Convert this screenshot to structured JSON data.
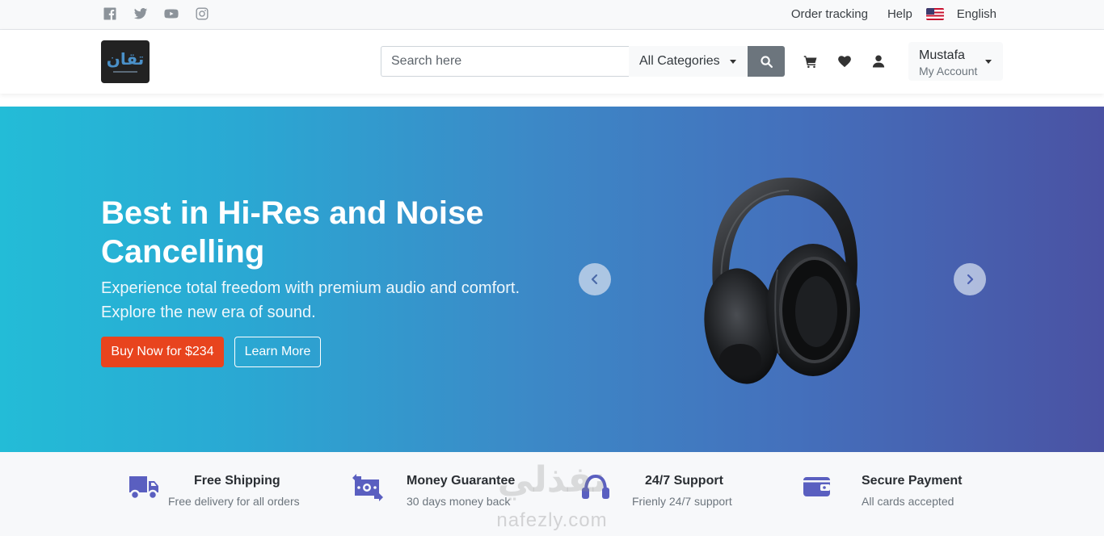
{
  "topbar": {
    "social": [
      "facebook-icon",
      "twitter-icon",
      "youtube-icon",
      "instagram-icon"
    ],
    "links": {
      "order_tracking": "Order tracking",
      "help": "Help"
    },
    "language": "English"
  },
  "header": {
    "logo_text": "تقان",
    "search": {
      "placeholder": "Search here",
      "category": "All Categories"
    },
    "account": {
      "name": "Mustafa",
      "label": "My Account"
    }
  },
  "hero": {
    "title": "Best in Hi-Res and Noise Cancelling",
    "subtitle": "Experience total freedom with premium audio and comfort. Explore the new era of sound.",
    "buy_label": "Buy Now for $234",
    "learn_label": "Learn More"
  },
  "features": [
    {
      "icon": "truck-icon",
      "title": "Free Shipping",
      "subtitle": "Free delivery for all orders"
    },
    {
      "icon": "money-icon",
      "title": "Money Guarantee",
      "subtitle": "30 days money back"
    },
    {
      "icon": "headset-icon",
      "title": "24/7 Support",
      "subtitle": "Frienly 24/7 support"
    },
    {
      "icon": "wallet-icon",
      "title": "Secure Payment",
      "subtitle": "All cards accepted"
    }
  ],
  "watermark": {
    "arabic": "نفذلي",
    "latin": "nafezly.com"
  },
  "colors": {
    "accent": "#e8441e",
    "icon": "#5a5fc0",
    "hero_start": "#23bcd7",
    "hero_end": "#4a52a3"
  }
}
